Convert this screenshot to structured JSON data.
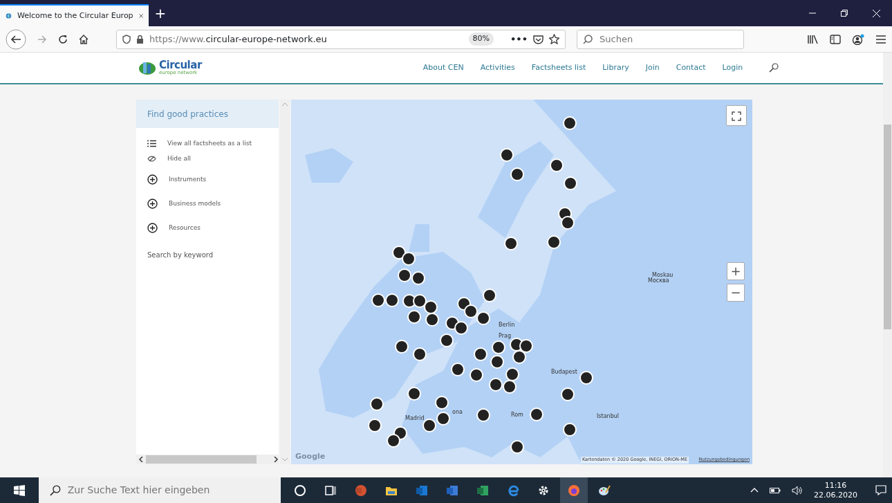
{
  "browser": {
    "tab_title": "Welcome to the Circular Europ",
    "new_tab": "+",
    "url_prefix": "https://www.",
    "url_domain": "circular-europe-network.eu",
    "zoom": "80%",
    "more": "•••",
    "search_placeholder": "Suchen"
  },
  "site": {
    "logo_text": "Circular",
    "logo_subtext": "europe network",
    "nav": [
      {
        "label": "About CEN"
      },
      {
        "label": "Activities"
      },
      {
        "label": "Factsheets list"
      },
      {
        "label": "Library"
      },
      {
        "label": "Join"
      },
      {
        "label": "Contact"
      },
      {
        "label": "Login"
      }
    ]
  },
  "sidebar": {
    "title": "Find good practices",
    "links": [
      {
        "kind": "list",
        "label": "View all factsheets as a list"
      },
      {
        "kind": "hide",
        "label": "Hide all"
      }
    ],
    "categories": [
      {
        "label": "Instruments",
        "expanded": false
      },
      {
        "label": "Business models",
        "expanded": false
      },
      {
        "label": "Resources",
        "expanded": false
      }
    ],
    "search_label": "Search by keyword"
  },
  "map": {
    "zoom_in": "+",
    "zoom_out": "−",
    "labels": [
      {
        "text": "Moskau"
      },
      {
        "text": "Москва"
      },
      {
        "text": "Berlin"
      },
      {
        "text": "Prag"
      },
      {
        "text": "Budapest"
      },
      {
        "text": "Madrid"
      },
      {
        "text": "ona"
      },
      {
        "text": "Rom"
      },
      {
        "text": "Istanbul"
      }
    ],
    "google": "Google",
    "attribution": "Kartendaten © 2020 Google, INEGI, ORION-ME",
    "terms": "Nutzungsbedingungen"
  },
  "taskbar": {
    "search_placeholder": "Zur Suche Text hier eingeben",
    "time": "11:16",
    "date": "22.06.2020"
  }
}
